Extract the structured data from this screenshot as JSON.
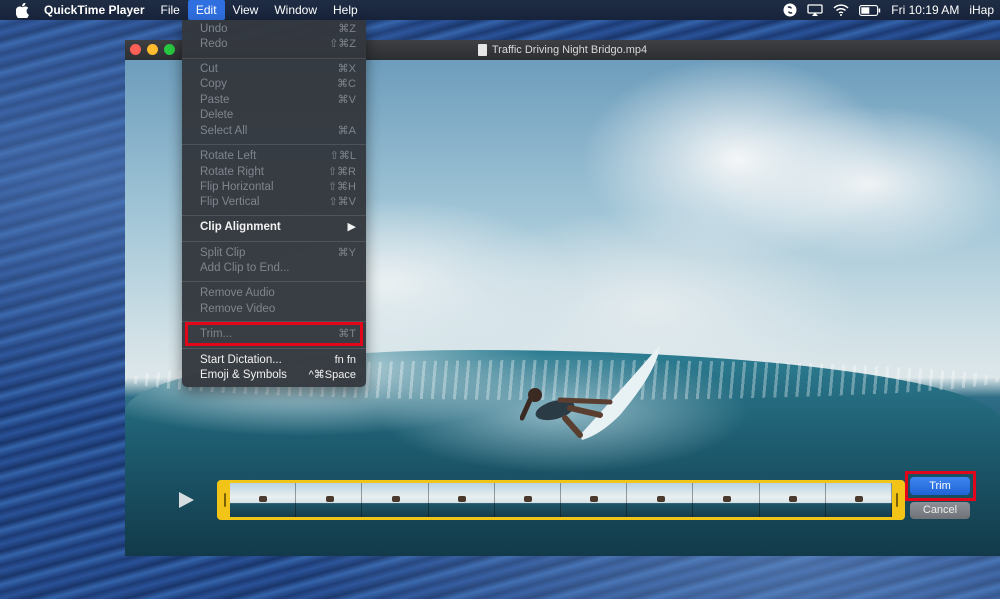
{
  "menubar": {
    "app_name": "QuickTime Player",
    "menus": [
      "File",
      "Edit",
      "View",
      "Window",
      "Help"
    ],
    "active_menu": "Edit",
    "clock": "Fri 10:19 AM",
    "user": "iHap"
  },
  "window": {
    "title": "Traffic Driving Night Bridgo.mp4"
  },
  "edit_menu": {
    "items": [
      {
        "label": "Undo",
        "shortcut": "⌘Z",
        "enabled": false
      },
      {
        "label": "Redo",
        "shortcut": "⇧⌘Z",
        "enabled": false
      },
      {
        "label": "Cut",
        "shortcut": "⌘X",
        "enabled": false
      },
      {
        "label": "Copy",
        "shortcut": "⌘C",
        "enabled": false
      },
      {
        "label": "Paste",
        "shortcut": "⌘V",
        "enabled": false
      },
      {
        "label": "Delete",
        "shortcut": "",
        "enabled": false
      },
      {
        "label": "Select All",
        "shortcut": "⌘A",
        "enabled": false
      },
      {
        "label": "Rotate Left",
        "shortcut": "⇧⌘L",
        "enabled": false
      },
      {
        "label": "Rotate Right",
        "shortcut": "⇧⌘R",
        "enabled": false
      },
      {
        "label": "Flip Horizontal",
        "shortcut": "⇧⌘H",
        "enabled": false
      },
      {
        "label": "Flip Vertical",
        "shortcut": "⇧⌘V",
        "enabled": false
      },
      {
        "label": "Clip Alignment",
        "shortcut": "▶",
        "enabled": true
      },
      {
        "label": "Split Clip",
        "shortcut": "⌘Y",
        "enabled": false
      },
      {
        "label": "Add Clip to End...",
        "shortcut": "",
        "enabled": false
      },
      {
        "label": "Remove Audio",
        "shortcut": "",
        "enabled": false
      },
      {
        "label": "Remove Video",
        "shortcut": "",
        "enabled": false
      },
      {
        "label": "Trim...",
        "shortcut": "⌘T",
        "enabled": false
      },
      {
        "label": "Start Dictation...",
        "shortcut": "fn fn",
        "enabled": true
      },
      {
        "label": "Emoji & Symbols",
        "shortcut": "^⌘Space",
        "enabled": true
      }
    ]
  },
  "trim_controls": {
    "trim_label": "Trim",
    "cancel_label": "Cancel"
  },
  "colors": {
    "accent": "#2f6fdf",
    "highlight": "#e3061b",
    "trim_bar": "#f2c417"
  }
}
